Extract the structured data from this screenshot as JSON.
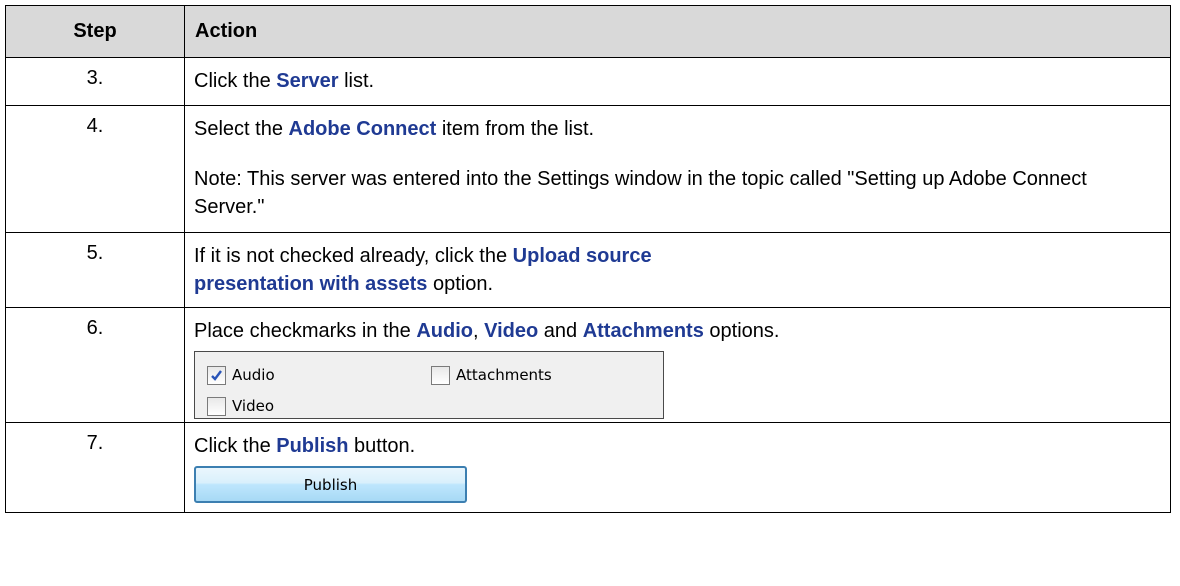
{
  "headers": {
    "step": "Step",
    "action": "Action"
  },
  "rows": [
    {
      "step": "3.",
      "pre": "Click the ",
      "hl": "Server",
      "post": " list."
    },
    {
      "step": "4.",
      "pre": "Select the ",
      "hl": "Adobe Connect",
      "post": " item from the list.",
      "note": "Note: This server was entered into the Settings window in the topic called \"Setting up Adobe Connect Server.\""
    },
    {
      "step": "5.",
      "pre": "If it is not checked already, click the ",
      "hl": "Upload source presentation with assets",
      "post": " option."
    },
    {
      "step": "6.",
      "pre": "Place checkmarks in the ",
      "hl1": "Audio",
      "mid1": ", ",
      "hl2": "Video",
      "mid2": " and ",
      "hl3": "Attachments",
      "post": " options."
    },
    {
      "step": "7.",
      "pre": "Click the ",
      "hl": "Publish",
      "post": " button."
    }
  ],
  "checkbox_panel": {
    "audio": {
      "label": "Audio",
      "checked": true
    },
    "attachments": {
      "label": "Attachments",
      "checked": false
    },
    "video": {
      "label": "Video",
      "checked": false
    }
  },
  "publish_button": {
    "label": "Publish"
  },
  "colors": {
    "header_bg": "#d9d9d9",
    "highlight": "#1f3a93"
  }
}
